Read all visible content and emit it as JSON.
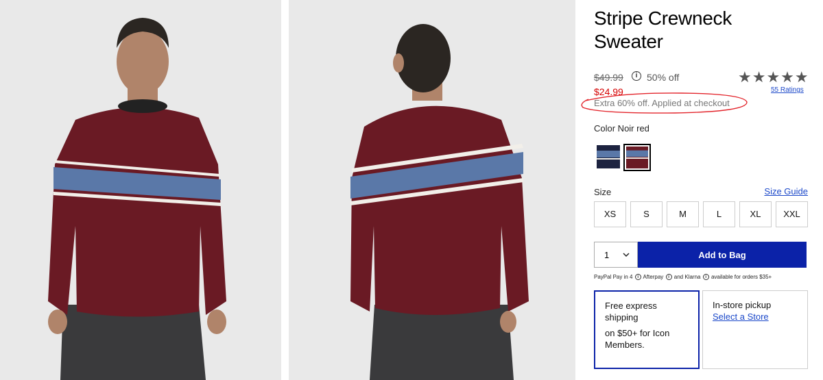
{
  "product": {
    "title": "Stripe Crewneck Sweater",
    "original_price": "$49.99",
    "discount": "50% off",
    "sale_price": "$24.99",
    "extra_offer": "Extra 60% off. Applied at checkout",
    "rating_stars": "★★★★★",
    "ratings_link": "55 Ratings",
    "colors": {
      "sweater": "#6a1a24",
      "stripe_blue": "#5a78a8",
      "stripe_white": "#f2efe9",
      "jeans": "#3a3a3c",
      "skin": "#b0846a",
      "hair": "#2b2622",
      "accent_blue": "#0b22a8",
      "sale_red": "#d50000"
    }
  },
  "color_section": {
    "label": "Color Noir red",
    "swatches": [
      {
        "name": "Navy",
        "selected": false
      },
      {
        "name": "Noir red",
        "selected": true
      }
    ]
  },
  "size_section": {
    "label": "Size",
    "guide_link": "Size Guide",
    "sizes": [
      "XS",
      "S",
      "M",
      "L",
      "XL",
      "XXL"
    ]
  },
  "purchase": {
    "quantity": "1",
    "add_to_bag": "Add to Bag",
    "paylater": {
      "paypal": "PayPal Pay in 4",
      "afterpay": "Afterpay",
      "and": "and",
      "klarna": "Klarna",
      "availability": "available for orders $35+"
    }
  },
  "fulfillment": {
    "shipping_line1": "Free express shipping",
    "shipping_line2": "on $50+ for Icon Members.",
    "pickup_title": "In-store pickup",
    "pickup_link": "Select a Store"
  }
}
